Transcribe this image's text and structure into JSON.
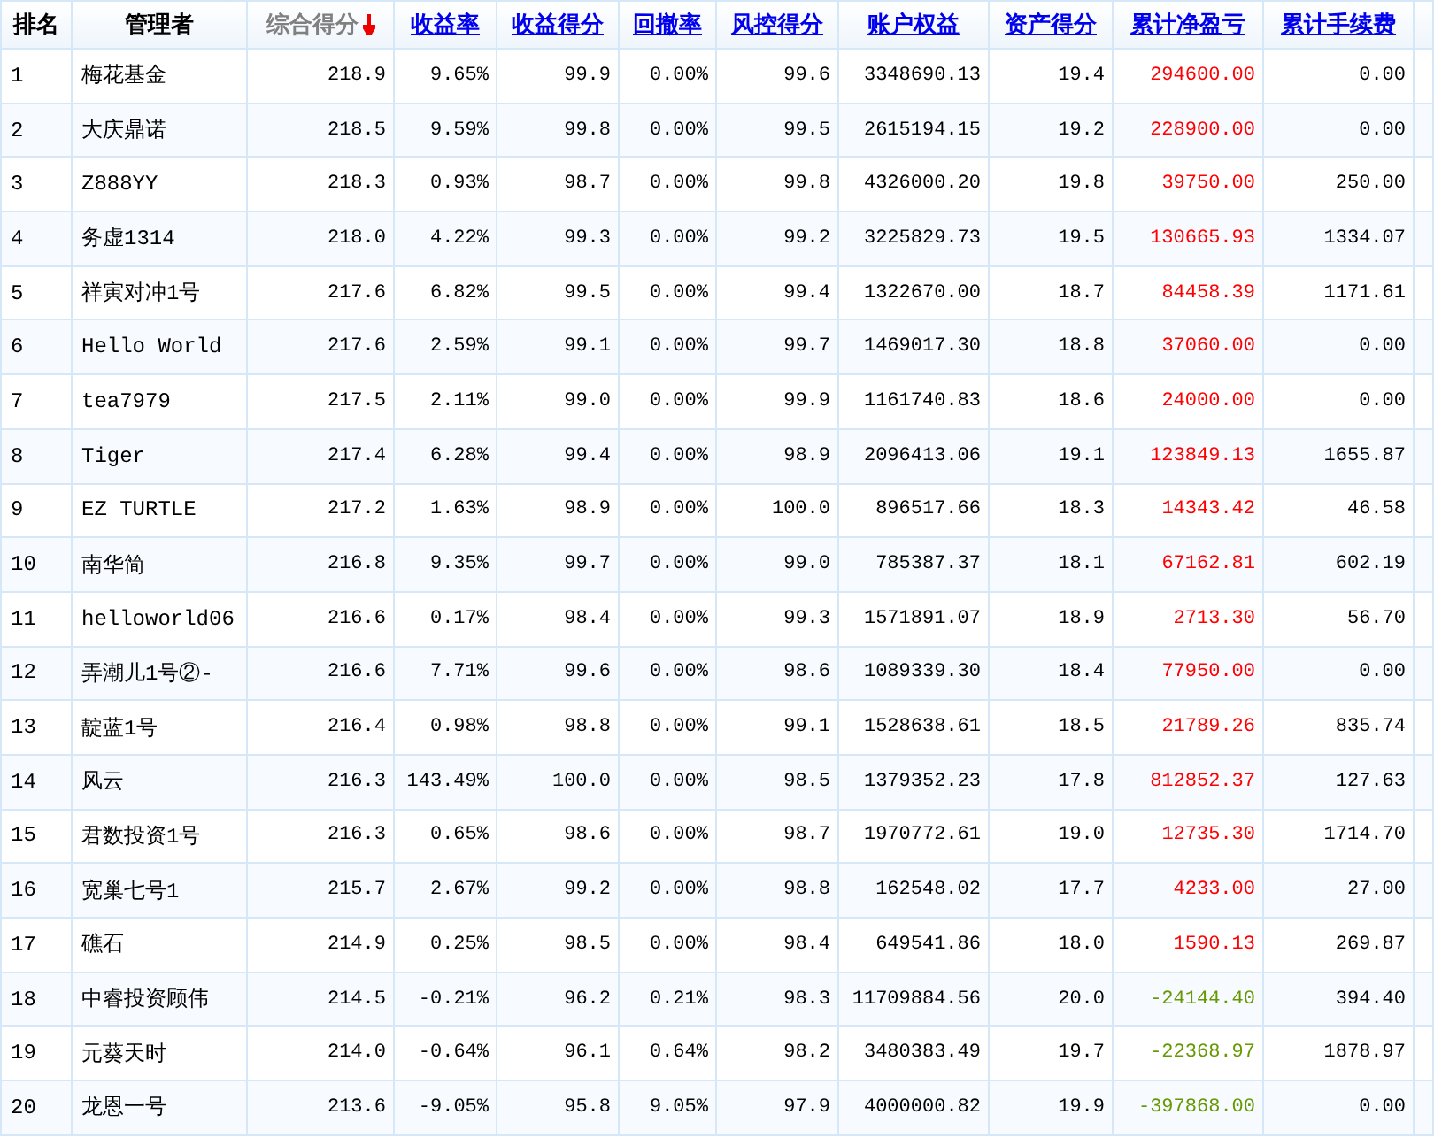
{
  "table": {
    "columns": [
      {
        "label": "排名",
        "kind": "plain"
      },
      {
        "label": "管理者",
        "kind": "plain"
      },
      {
        "label": "综合得分",
        "kind": "sorted"
      },
      {
        "label": "收益率",
        "kind": "link"
      },
      {
        "label": "收益得分",
        "kind": "link"
      },
      {
        "label": "回撤率",
        "kind": "link"
      },
      {
        "label": "风控得分",
        "kind": "link"
      },
      {
        "label": "账户权益",
        "kind": "link"
      },
      {
        "label": "资产得分",
        "kind": "link"
      },
      {
        "label": "累计净盈亏",
        "kind": "link"
      },
      {
        "label": "累计手续费",
        "kind": "link"
      }
    ],
    "rows": [
      {
        "cells": [
          "1",
          "梅花基金",
          "218.9",
          "9.65%",
          "99.9",
          "0.00%",
          "99.6",
          "3348690.13",
          "19.4"
        ],
        "pnl": {
          "value": "294600.00",
          "color": "#ff0000"
        },
        "fee": "0.00"
      },
      {
        "cells": [
          "2",
          "大庆鼎诺",
          "218.5",
          "9.59%",
          "99.8",
          "0.00%",
          "99.5",
          "2615194.15",
          "19.2"
        ],
        "pnl": {
          "value": "228900.00",
          "color": "#ff0000"
        },
        "fee": "0.00"
      },
      {
        "cells": [
          "3",
          "Z888YY",
          "218.3",
          "0.93%",
          "98.7",
          "0.00%",
          "99.8",
          "4326000.20",
          "19.8"
        ],
        "pnl": {
          "value": "39750.00",
          "color": "#ff0000"
        },
        "fee": "250.00"
      },
      {
        "cells": [
          "4",
          "务虚1314",
          "218.0",
          "4.22%",
          "99.3",
          "0.00%",
          "99.2",
          "3225829.73",
          "19.5"
        ],
        "pnl": {
          "value": "130665.93",
          "color": "#ff0000"
        },
        "fee": "1334.07"
      },
      {
        "cells": [
          "5",
          "祥寅对冲1号",
          "217.6",
          "6.82%",
          "99.5",
          "0.00%",
          "99.4",
          "1322670.00",
          "18.7"
        ],
        "pnl": {
          "value": "84458.39",
          "color": "#ff0000"
        },
        "fee": "1171.61"
      },
      {
        "cells": [
          "6",
          "Hello World",
          "217.6",
          "2.59%",
          "99.1",
          "0.00%",
          "99.7",
          "1469017.30",
          "18.8"
        ],
        "pnl": {
          "value": "37060.00",
          "color": "#ff0000"
        },
        "fee": "0.00"
      },
      {
        "cells": [
          "7",
          "tea7979",
          "217.5",
          "2.11%",
          "99.0",
          "0.00%",
          "99.9",
          "1161740.83",
          "18.6"
        ],
        "pnl": {
          "value": "24000.00",
          "color": "#ff0000"
        },
        "fee": "0.00"
      },
      {
        "cells": [
          "8",
          "Tiger",
          "217.4",
          "6.28%",
          "99.4",
          "0.00%",
          "98.9",
          "2096413.06",
          "19.1"
        ],
        "pnl": {
          "value": "123849.13",
          "color": "#ff0000"
        },
        "fee": "1655.87"
      },
      {
        "cells": [
          "9",
          "EZ TURTLE",
          "217.2",
          "1.63%",
          "98.9",
          "0.00%",
          "100.0",
          "896517.66",
          "18.3"
        ],
        "pnl": {
          "value": "14343.42",
          "color": "#ff0000"
        },
        "fee": "46.58"
      },
      {
        "cells": [
          "10",
          "南华简",
          "216.8",
          "9.35%",
          "99.7",
          "0.00%",
          "99.0",
          "785387.37",
          "18.1"
        ],
        "pnl": {
          "value": "67162.81",
          "color": "#ff0000"
        },
        "fee": "602.19"
      },
      {
        "cells": [
          "11",
          "helloworld06",
          "216.6",
          "0.17%",
          "98.4",
          "0.00%",
          "99.3",
          "1571891.07",
          "18.9"
        ],
        "pnl": {
          "value": "2713.30",
          "color": "#ff0000"
        },
        "fee": "56.70"
      },
      {
        "cells": [
          "12",
          "弄潮儿1号②-",
          "216.6",
          "7.71%",
          "99.6",
          "0.00%",
          "98.6",
          "1089339.30",
          "18.4"
        ],
        "pnl": {
          "value": "77950.00",
          "color": "#ff0000"
        },
        "fee": "0.00"
      },
      {
        "cells": [
          "13",
          "靛蓝1号",
          "216.4",
          "0.98%",
          "98.8",
          "0.00%",
          "99.1",
          "1528638.61",
          "18.5"
        ],
        "pnl": {
          "value": "21789.26",
          "color": "#ff0000"
        },
        "fee": "835.74"
      },
      {
        "cells": [
          "14",
          "风云",
          "216.3",
          "143.49%",
          "100.0",
          "0.00%",
          "98.5",
          "1379352.23",
          "17.8"
        ],
        "pnl": {
          "value": "812852.37",
          "color": "#ff0000"
        },
        "fee": "127.63"
      },
      {
        "cells": [
          "15",
          "君数投资1号",
          "216.3",
          "0.65%",
          "98.6",
          "0.00%",
          "98.7",
          "1970772.61",
          "19.0"
        ],
        "pnl": {
          "value": "12735.30",
          "color": "#ff0000"
        },
        "fee": "1714.70"
      },
      {
        "cells": [
          "16",
          "宽巢七号1",
          "215.7",
          "2.67%",
          "99.2",
          "0.00%",
          "98.8",
          "162548.02",
          "17.7"
        ],
        "pnl": {
          "value": "4233.00",
          "color": "#ff0000"
        },
        "fee": "27.00"
      },
      {
        "cells": [
          "17",
          "礁石",
          "214.9",
          "0.25%",
          "98.5",
          "0.00%",
          "98.4",
          "649541.86",
          "18.0"
        ],
        "pnl": {
          "value": "1590.13",
          "color": "#ff0000"
        },
        "fee": "269.87"
      },
      {
        "cells": [
          "18",
          "中睿投资顾伟",
          "214.5",
          "-0.21%",
          "96.2",
          "0.21%",
          "98.3",
          "11709884.56",
          "20.0"
        ],
        "pnl": {
          "value": "-24144.40",
          "color": "#669900"
        },
        "fee": "394.40"
      },
      {
        "cells": [
          "19",
          "元葵天时",
          "214.0",
          "-0.64%",
          "96.1",
          "0.64%",
          "98.2",
          "3480383.49",
          "19.7"
        ],
        "pnl": {
          "value": "-22368.97",
          "color": "#669900"
        },
        "fee": "1878.97"
      },
      {
        "cells": [
          "20",
          "龙恩一号",
          "213.6",
          "-9.05%",
          "95.8",
          "9.05%",
          "97.9",
          "4000000.82",
          "19.9"
        ],
        "pnl": {
          "value": "-397868.00",
          "color": "#669900"
        },
        "fee": "0.00"
      }
    ]
  }
}
